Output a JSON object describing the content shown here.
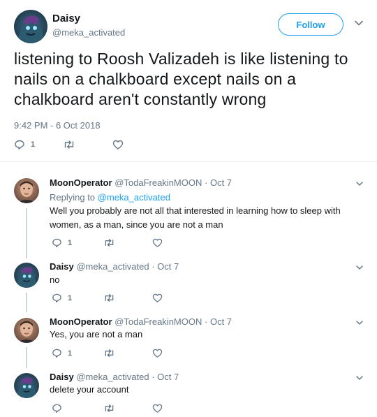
{
  "main_tweet": {
    "name": "Daisy",
    "handle": "@meka_activated",
    "follow_label": "Follow",
    "text": "listening to Roosh Valizadeh is like listening to nails on a chalkboard except nails on a chalkboard aren't constantly wrong",
    "timestamp": "9:42 PM - 6 Oct 2018",
    "reply_count": "1"
  },
  "replies": [
    {
      "name": "MoonOperator",
      "handle": "@TodaFreakinMOON",
      "sep": "·",
      "date": "Oct 7",
      "replying_prefix": "Replying to",
      "replying_to": "@meka_activated",
      "text": "Well you probably are not all that interested in learning how to sleep with women, as a man, since you are not a man",
      "reply_count": "1"
    },
    {
      "name": "Daisy",
      "handle": "@meka_activated",
      "sep": "·",
      "date": "Oct 7",
      "text": "no",
      "reply_count": "1"
    },
    {
      "name": "MoonOperator",
      "handle": "@TodaFreakinMOON",
      "sep": "·",
      "date": "Oct 7",
      "text": "Yes, you are not a man",
      "reply_count": "1"
    },
    {
      "name": "Daisy",
      "handle": "@meka_activated",
      "sep": "·",
      "date": "Oct 7",
      "text": "delete your account",
      "reply_count": ""
    }
  ],
  "icons": {
    "reply": "reply-icon",
    "retweet": "retweet-icon",
    "like": "heart-icon",
    "menu": "chevron-down-icon"
  },
  "colors": {
    "accent": "#1da1f2",
    "muted": "#657786",
    "text": "#14171a"
  }
}
